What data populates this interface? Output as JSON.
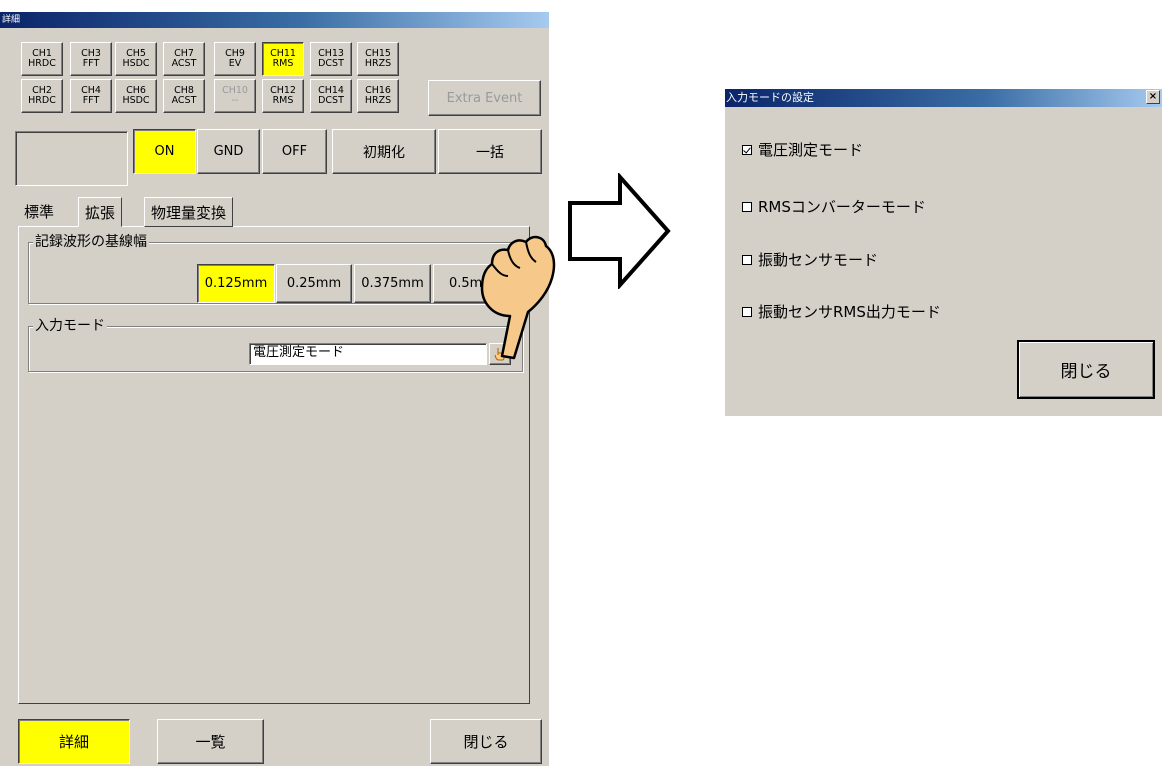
{
  "left_window": {
    "title": "詳細",
    "channels_row1": [
      {
        "ch": "CH1",
        "mode": "HRDC"
      },
      {
        "ch": "CH3",
        "mode": "FFT"
      },
      {
        "ch": "CH5",
        "mode": "HSDC"
      },
      {
        "ch": "CH7",
        "mode": "ACST"
      },
      {
        "ch": "CH9",
        "mode": "EV"
      },
      {
        "ch": "CH11",
        "mode": "RMS"
      },
      {
        "ch": "CH13",
        "mode": "DCST"
      },
      {
        "ch": "CH15",
        "mode": "HRZS"
      }
    ],
    "channels_row2": [
      {
        "ch": "CH2",
        "mode": "HRDC"
      },
      {
        "ch": "CH4",
        "mode": "FFT"
      },
      {
        "ch": "CH6",
        "mode": "HSDC"
      },
      {
        "ch": "CH8",
        "mode": "ACST"
      },
      {
        "ch": "CH10",
        "mode": "--"
      },
      {
        "ch": "CH12",
        "mode": "RMS"
      },
      {
        "ch": "CH14",
        "mode": "DCST"
      },
      {
        "ch": "CH16",
        "mode": "HRZS"
      }
    ],
    "selected_channel": "CH11",
    "extra_event_label": "Extra Event",
    "on_label": "ON",
    "gnd_label": "GND",
    "off_label": "OFF",
    "init_label": "初期化",
    "batch_label": "一括",
    "tabs": [
      "標準",
      "拡張",
      "物理量変換"
    ],
    "active_tab": "拡張",
    "baseline_group": {
      "label": "記録波形の基線幅",
      "options": [
        "0.125mm",
        "0.25mm",
        "0.375mm",
        "0.5mm"
      ],
      "selected": "0.125mm"
    },
    "input_mode_group": {
      "label": "入力モード",
      "value": "電圧測定モード"
    },
    "bottom": {
      "detail_label": "詳細",
      "list_label": "一覧",
      "close_label": "閉じる"
    },
    "highlight_color": "#ffff00"
  },
  "dialog": {
    "title": "入力モードの設定",
    "close_x": "×",
    "options": [
      {
        "label": "電圧測定モード",
        "checked": true
      },
      {
        "label": "RMSコンバーターモード",
        "checked": false
      },
      {
        "label": "振動センサモード",
        "checked": false
      },
      {
        "label": "振動センサRMS出力モード",
        "checked": false
      }
    ],
    "close_label": "閉じる"
  },
  "icons": [
    "pointing-hand-icon",
    "right-arrow-icon",
    "hand-cursor-icon"
  ]
}
